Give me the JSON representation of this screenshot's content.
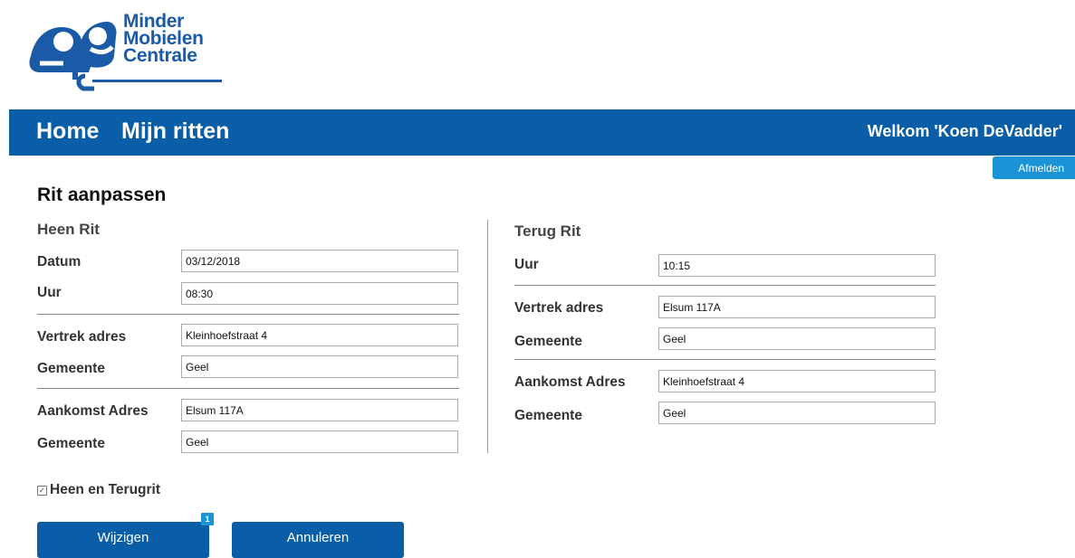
{
  "logo": {
    "line1": "Minder",
    "line2": "Mobielen",
    "line3": "Centrale"
  },
  "nav": {
    "home": "Home",
    "mijn_ritten": "Mijn ritten",
    "welcome": "Welkom 'Koen DeVadder'",
    "logout": "Afmelden"
  },
  "page_title": "Rit aanpassen",
  "heen": {
    "title": "Heen Rit",
    "datum_label": "Datum",
    "datum_value": "03/12/2018",
    "uur_label": "Uur",
    "uur_value": "08:30",
    "vertrek_label": "Vertrek adres",
    "vertrek_value": "Kleinhoefstraat 4",
    "gemeente1_label": "Gemeente",
    "gemeente1_value": "Geel",
    "aankomst_label": "Aankomst Adres",
    "aankomst_value": "Elsum 117A",
    "gemeente2_label": "Gemeente",
    "gemeente2_value": "Geel"
  },
  "terug": {
    "title": "Terug Rit",
    "uur_label": "Uur",
    "uur_value": "10:15",
    "vertrek_label": "Vertrek adres",
    "vertrek_value": "Elsum 117A",
    "gemeente1_label": "Gemeente",
    "gemeente1_value": "Geel",
    "aankomst_label": "Aankomst Adres",
    "aankomst_value": "Kleinhoefstraat 4",
    "gemeente2_label": "Gemeente",
    "gemeente2_value": "Geel"
  },
  "checkbox": {
    "label": "Heen en Terugrit",
    "checked": true
  },
  "buttons": {
    "wijzigen": "Wijzigen",
    "badge": "1",
    "annuleren": "Annuleren"
  },
  "colors": {
    "brand_blue": "#0a5ea8",
    "accent_blue": "#1a94d6"
  }
}
